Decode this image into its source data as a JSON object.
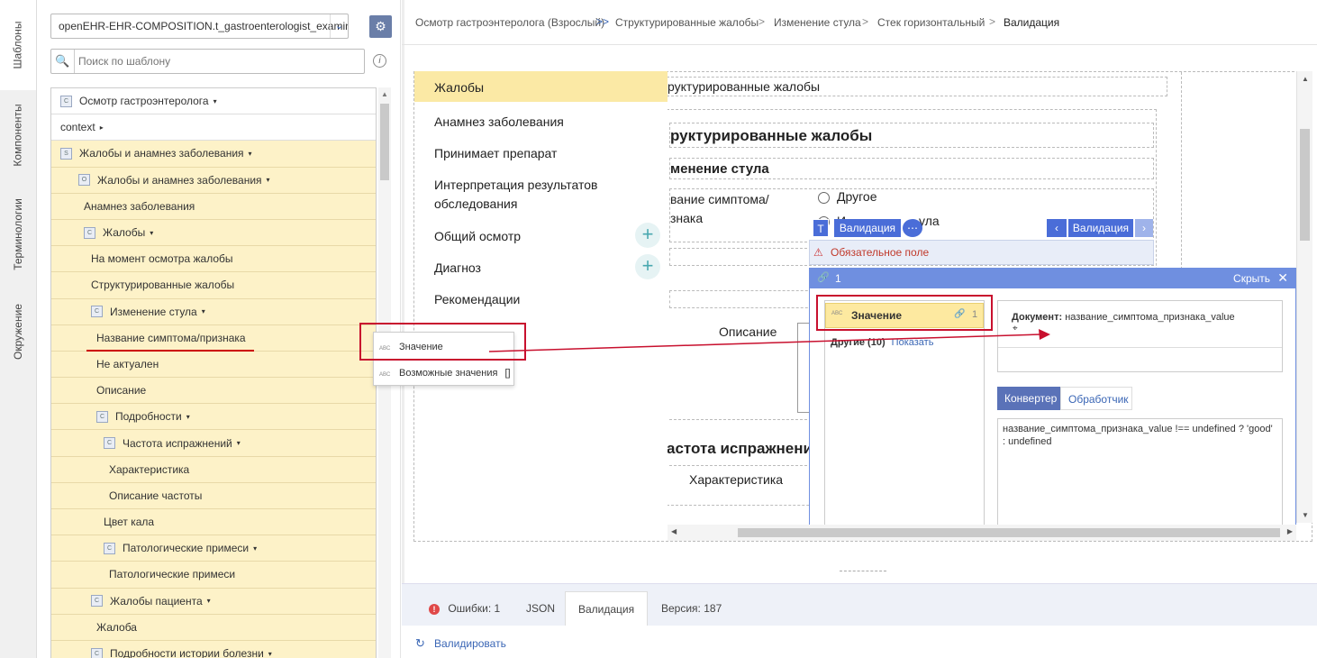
{
  "side_tabs": [
    "Шаблоны",
    "Компоненты",
    "Терминологии",
    "Окружение"
  ],
  "template_select": {
    "value": "openEHR-EHR-COMPOSITION.t_gastroenterologist_examinati...",
    "arrow": "⌄"
  },
  "gear_icon": "⚙",
  "search": {
    "placeholder": "Поиск по шаблону",
    "icon": "🔍",
    "info": "i"
  },
  "tree": [
    {
      "label": "Осмотр гастроэнтеролога",
      "indent": 0,
      "icon": "C",
      "caret": "▾",
      "bg": "white"
    },
    {
      "label": "context",
      "indent": 0,
      "icon": "",
      "caret": "▸",
      "bg": "white"
    },
    {
      "label": "Жалобы и анамнез заболевания",
      "indent": 0,
      "icon": "S",
      "caret": "▾",
      "bg": "yellow"
    },
    {
      "label": "Жалобы и анамнез заболевания",
      "indent": 1,
      "icon": "O",
      "caret": "▾",
      "bg": "yellow"
    },
    {
      "label": "Анамнез заболевания",
      "indent": 2,
      "icon": "",
      "caret": "",
      "bg": "yellow"
    },
    {
      "label": "Жалобы",
      "indent": 2,
      "icon": "C",
      "caret": "▾",
      "bg": "yellow"
    },
    {
      "label": "На момент осмотра жалобы",
      "indent": 3,
      "icon": "",
      "caret": "",
      "bg": "yellow"
    },
    {
      "label": "Структурированные жалобы",
      "indent": 3,
      "icon": "",
      "caret": "",
      "bg": "yellow"
    },
    {
      "label": "Изменение стула",
      "indent": 3,
      "icon": "C",
      "caret": "▾",
      "bg": "yellow"
    },
    {
      "label": "Название симптома/признака",
      "indent": 4,
      "icon": "",
      "caret": "",
      "bg": "yellow"
    },
    {
      "label": "Не актуален",
      "indent": 4,
      "icon": "",
      "caret": "",
      "bg": "yellow"
    },
    {
      "label": "Описание",
      "indent": 4,
      "icon": "",
      "caret": "",
      "bg": "yellow"
    },
    {
      "label": "Подробности",
      "indent": 4,
      "icon": "C",
      "caret": "▾",
      "bg": "yellow"
    },
    {
      "label": "Частота испражнений",
      "indent": 5,
      "icon": "C",
      "caret": "▾",
      "bg": "yellow"
    },
    {
      "label": "Характеристика",
      "indent": 6,
      "icon": "",
      "caret": "",
      "bg": "yellow"
    },
    {
      "label": "Описание частоты",
      "indent": 6,
      "icon": "",
      "caret": "",
      "bg": "yellow"
    },
    {
      "label": "Цвет кала",
      "indent": 5,
      "icon": "",
      "caret": "",
      "bg": "yellow"
    },
    {
      "label": "Патологические примеси",
      "indent": 5,
      "icon": "C",
      "caret": "▾",
      "bg": "yellow"
    },
    {
      "label": "Патологические примеси",
      "indent": 6,
      "icon": "",
      "caret": "",
      "bg": "yellow"
    },
    {
      "label": "Жалобы пациента",
      "indent": 3,
      "icon": "C",
      "caret": "▾",
      "bg": "yellow"
    },
    {
      "label": "Жалоба",
      "indent": 4,
      "icon": "",
      "caret": "",
      "bg": "yellow"
    },
    {
      "label": "Подробности истории болезни",
      "indent": 3,
      "icon": "C",
      "caret": "▾",
      "bg": "yellow"
    }
  ],
  "breadcrumbs": [
    "Осмотр гастроэнтеролога (Взрослый)",
    "Структурированные жалобы",
    "Изменение стула",
    "Стек горизонтальный",
    "Валидация"
  ],
  "breadcrumb_seps": [
    ">>",
    ">",
    ">",
    ">"
  ],
  "nav_menu": [
    {
      "label": "Жалобы",
      "active": true,
      "plus": false
    },
    {
      "label": "Анамнез заболевания",
      "active": false,
      "plus": false
    },
    {
      "label": "Принимает препарат",
      "active": false,
      "plus": false
    },
    {
      "label": "Интерпретация результатов обследования",
      "active": false,
      "plus": false
    },
    {
      "label": "Общий осмотр",
      "active": false,
      "plus": true
    },
    {
      "label": "Диагноз",
      "active": false,
      "plus": true
    },
    {
      "label": "Рекомендации",
      "active": false,
      "plus": false
    }
  ],
  "plus_glyph": "+",
  "canvas": {
    "top_text": "руктурированные жалобы",
    "section_title": "руктурированные жалобы",
    "subsection_title": "менение стула",
    "symptom_label_1": "вание симптома/",
    "symptom_label_2": "знака",
    "radio_other": "Другое",
    "radio_partial": "И",
    "radio_partial_tail": "ула",
    "description": "Описание",
    "frequency_title": "астота испражнений",
    "characteristic": "Характеристика"
  },
  "validation_toolbar": {
    "t_icon": "T",
    "label_left": "Валидация",
    "more_icon": "⋯",
    "prev_icon": "‹",
    "label_right": "Валидация",
    "next_icon": "›"
  },
  "error_strip": {
    "icon": "⚠",
    "text": "Обязательное поле"
  },
  "popup": {
    "link_icon": "🔗",
    "count": "1",
    "hide_label": "Скрыть",
    "close_icon": "✕",
    "item_abc": "ABC",
    "item_label": "Значение",
    "item_link_icon": "🔗",
    "item_count": "1",
    "others_label": "Другие (10)",
    "show_label": "Показать",
    "doc_label": "Документ:",
    "doc_value": "название_симптома_признака_value",
    "cursor_icon": "⌖",
    "tabs": [
      "Конвертер",
      "Обработчик"
    ],
    "active_tab": 0,
    "code": "название_симптома_признака_value !== undefined ? 'good' : undefined"
  },
  "float_menu": [
    {
      "abc": "ABC",
      "label": "Значение",
      "suffix": ""
    },
    {
      "abc": "ABC",
      "label": "Возможные значения",
      "suffix": "[]"
    }
  ],
  "bottom_tabs": [
    {
      "label": "Ошибки: 1",
      "icon": "!",
      "active": false
    },
    {
      "label": "JSON",
      "icon": "",
      "active": false
    },
    {
      "label": "Валидация",
      "icon": "",
      "active": true
    },
    {
      "label": "Версия: 187",
      "icon": "",
      "active": false
    }
  ],
  "validate_action": {
    "icon": "↻",
    "label": "Валидировать"
  },
  "colors": {
    "accent": "#4a6dd8",
    "tree_yellow": "#fdf2c8",
    "highlight": "#fde9a0",
    "error": "#c0392b",
    "annotation_red": "#c8102e",
    "plus_teal": "#49a8b0"
  }
}
